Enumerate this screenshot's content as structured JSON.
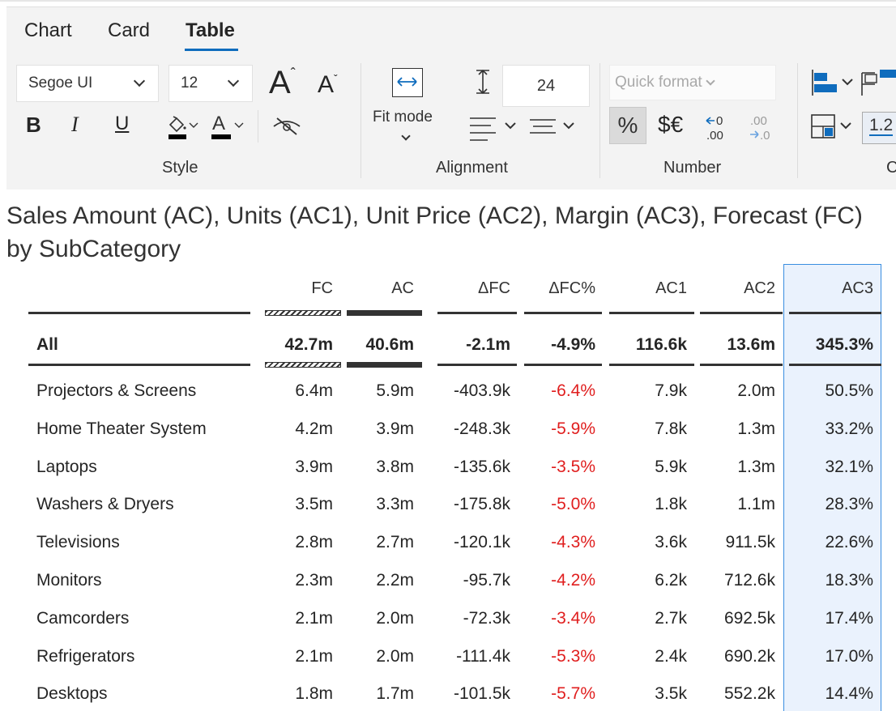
{
  "tabs": [
    {
      "label": "Chart"
    },
    {
      "label": "Card"
    },
    {
      "label": "Table"
    }
  ],
  "ribbon": {
    "style": {
      "font_family": "Segoe UI",
      "font_size": "12",
      "group_label": "Style"
    },
    "alignment": {
      "fit_mode_label": "Fit mode",
      "row_height": "24",
      "group_label": "Alignment"
    },
    "number": {
      "quick_format_placeholder": "Quick format",
      "group_label": "Number",
      "decimals_value": "1.2"
    },
    "cut_group_label": "C"
  },
  "title": "Sales Amount (AC), Units (AC1), Unit Price (AC2), Margin (AC3), Forecast (FC) by SubCategory",
  "table": {
    "columns": [
      "FC",
      "AC",
      "ΔFC",
      "ΔFC%",
      "AC1",
      "AC2",
      "AC3"
    ],
    "total": {
      "name": "All",
      "values": [
        "42.7m",
        "40.6m",
        "-2.1m",
        "-4.9%",
        "116.6k",
        "13.6m",
        "345.3%"
      ]
    },
    "rows": [
      {
        "name": "Projectors & Screens",
        "values": [
          "6.4m",
          "5.9m",
          "-403.9k",
          "-6.4%",
          "7.9k",
          "2.0m",
          "50.5%"
        ]
      },
      {
        "name": "Home Theater System",
        "values": [
          "4.2m",
          "3.9m",
          "-248.3k",
          "-5.9%",
          "7.8k",
          "1.3m",
          "33.2%"
        ]
      },
      {
        "name": "Laptops",
        "values": [
          "3.9m",
          "3.8m",
          "-135.6k",
          "-3.5%",
          "5.9k",
          "1.3m",
          "32.1%"
        ]
      },
      {
        "name": "Washers & Dryers",
        "values": [
          "3.5m",
          "3.3m",
          "-175.8k",
          "-5.0%",
          "1.8k",
          "1.1m",
          "28.3%"
        ]
      },
      {
        "name": "Televisions",
        "values": [
          "2.8m",
          "2.7m",
          "-120.1k",
          "-4.3%",
          "3.6k",
          "911.5k",
          "22.6%"
        ]
      },
      {
        "name": "Monitors",
        "values": [
          "2.3m",
          "2.2m",
          "-95.7k",
          "-4.2%",
          "6.2k",
          "712.6k",
          "18.3%"
        ]
      },
      {
        "name": "Camcorders",
        "values": [
          "2.1m",
          "2.0m",
          "-72.3k",
          "-3.4%",
          "2.7k",
          "692.5k",
          "17.4%"
        ]
      },
      {
        "name": "Refrigerators",
        "values": [
          "2.1m",
          "2.0m",
          "-111.4k",
          "-5.3%",
          "2.4k",
          "690.2k",
          "17.0%"
        ]
      },
      {
        "name": "Desktops",
        "values": [
          "1.8m",
          "1.7m",
          "-101.5k",
          "-5.7%",
          "3.5k",
          "552.2k",
          "14.4%"
        ]
      }
    ]
  },
  "colors": {
    "accent": "#0f6cbd",
    "negative": "#e01e1e",
    "selected_column_bg": "#eaf2fd",
    "selected_column_border": "#3a8ee0"
  }
}
